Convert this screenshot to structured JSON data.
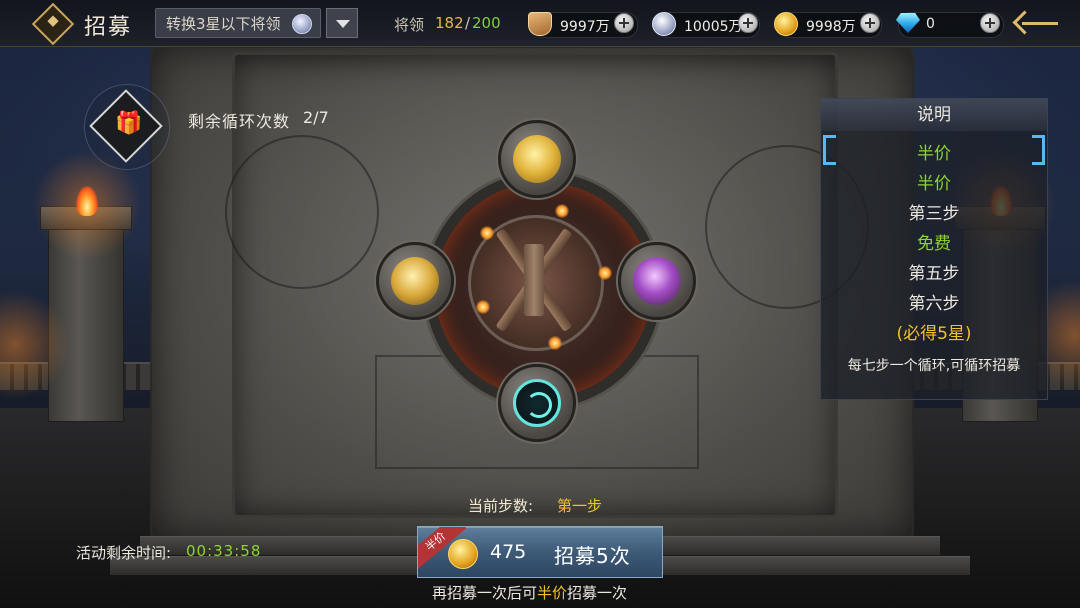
{
  "header": {
    "title": "招募",
    "convert_label": "转换3星以下将领",
    "generals_label": "将领",
    "generals_count": "182",
    "generals_sep": "/",
    "generals_max": "200"
  },
  "resources": [
    {
      "icon": "shield-icon",
      "value": "9997万"
    },
    {
      "icon": "silver-coin-icon",
      "value": "10005万"
    },
    {
      "icon": "gold-coin-icon",
      "value": "9998万"
    },
    {
      "icon": "diamond-icon",
      "value": "0"
    }
  ],
  "cycle": {
    "label": "剩余循环次数",
    "value": "2/7"
  },
  "current_step": {
    "label": "当前步数:",
    "value": "第一步"
  },
  "panel": {
    "title": "说明",
    "steps": [
      {
        "text": "半价",
        "color": "green"
      },
      {
        "text": "半价",
        "color": "green"
      },
      {
        "text": "第三步",
        "color": "white"
      },
      {
        "text": "免费",
        "color": "green"
      },
      {
        "text": "第五步",
        "color": "white"
      },
      {
        "text": "第六步",
        "color": "white"
      },
      {
        "text": "(必得5星)",
        "color": "gold"
      }
    ],
    "note": "每七步一个循环,可循环招募"
  },
  "timer": {
    "label": "活动剩余时间:",
    "value": "00:33:58"
  },
  "recruit_button": {
    "badge": "半价",
    "cost": "475",
    "label": "招募5次"
  },
  "hint": {
    "prefix": "再招募一次后可",
    "highlight": "半价",
    "suffix": "招募一次"
  },
  "colors": {
    "accent_gold": "#f0c22a",
    "accent_green": "#8cd52e",
    "button_blue": "#3d5a77"
  }
}
